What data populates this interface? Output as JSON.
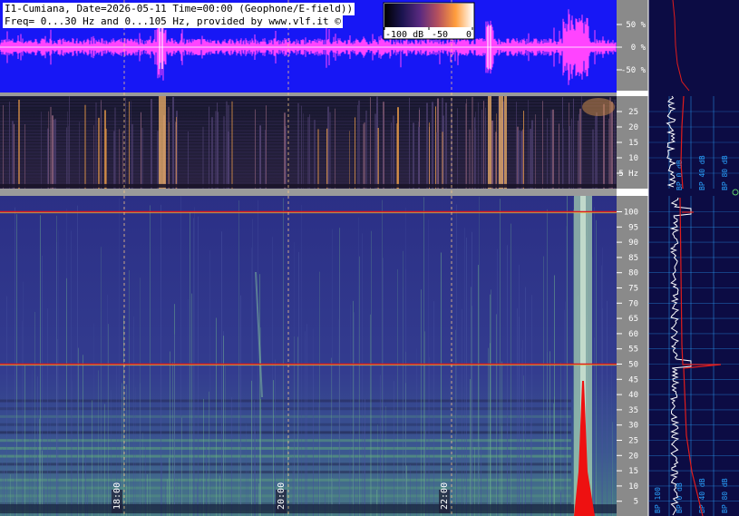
{
  "header": {
    "line1": "I1-Cumiana, Date=2026-05-11 Time=00:00 (Geophone/E-field))",
    "line2": "Freq= 0...30 Hz and 0...105 Hz, provided by www.vlf.it ©"
  },
  "colorbar": {
    "ticks": [
      "-100 dB",
      "-50",
      "0"
    ],
    "stops": [
      "#000000",
      "#1b1450",
      "#5a2a80",
      "#b5505e",
      "#ff9d3c",
      "#ffffff"
    ]
  },
  "colors": {
    "waveform_bg": "#1717f5",
    "waveform": "#ff44ff",
    "panel_bg": "#0c0c44",
    "red_trace": "#e01c1c",
    "grid": "#2aa3ff"
  },
  "chart_data": [
    {
      "type": "line",
      "name": "waveform",
      "y_ticks": [
        "50 %",
        "0 %",
        "-50 %"
      ],
      "ylim": [
        -100,
        100
      ]
    },
    {
      "type": "heatmap",
      "name": "low-frequency spectrogram",
      "ylim": [
        0,
        30
      ],
      "y_ticks": [
        "25",
        "20",
        "15",
        "10",
        "5 Hz"
      ],
      "y_tick_values": [
        25,
        20,
        15,
        10,
        5
      ]
    },
    {
      "type": "heatmap",
      "name": "high-frequency spectrogram",
      "ylim": [
        0,
        105
      ],
      "y_ticks": [
        "100",
        "95",
        "90",
        "85",
        "80",
        "75",
        "70",
        "65",
        "60",
        "55",
        "50",
        "45",
        "40",
        "35",
        "30",
        "25",
        "20",
        "15",
        "10",
        "5"
      ],
      "y_tick_values": [
        100,
        95,
        90,
        85,
        80,
        75,
        70,
        65,
        60,
        55,
        50,
        45,
        40,
        35,
        30,
        25,
        20,
        15,
        10,
        5
      ],
      "time_ticks": [
        "18:00",
        "20:00",
        "22:00"
      ],
      "horizontal_lines_hz": [
        100,
        50
      ]
    },
    {
      "type": "line",
      "name": "band power",
      "side_labels": [
        "BP 0 dB",
        "BP 40 dB",
        "BP 80 dB"
      ],
      "bottom_labels": [
        "BP 100",
        "BP 0 dB",
        "BP 40 dB",
        "BP 80 dB"
      ]
    }
  ]
}
